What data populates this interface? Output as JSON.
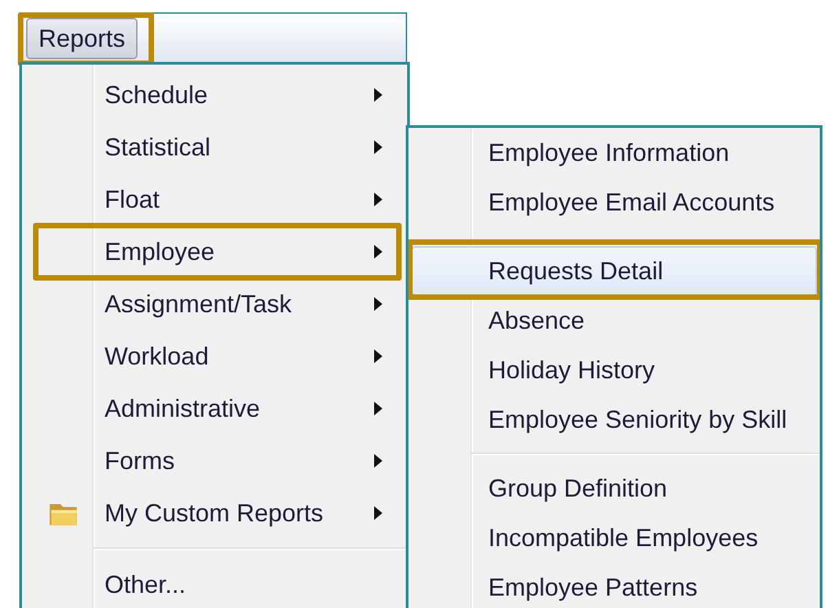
{
  "menu_bar": {
    "title": {
      "label": "Reports",
      "outlined": true
    }
  },
  "menu": {
    "items": [
      {
        "kind": "item",
        "label": "Schedule",
        "submenu": true,
        "outlined": false
      },
      {
        "kind": "item",
        "label": "Statistical",
        "submenu": true,
        "outlined": false
      },
      {
        "kind": "item",
        "label": "Float",
        "submenu": true,
        "outlined": false
      },
      {
        "kind": "item",
        "label": "Employee",
        "submenu": true,
        "outlined": true
      },
      {
        "kind": "item",
        "label": "Assignment/Task",
        "submenu": true,
        "outlined": false
      },
      {
        "kind": "item",
        "label": "Workload",
        "submenu": true,
        "outlined": false
      },
      {
        "kind": "item",
        "label": "Administrative",
        "submenu": true,
        "outlined": false
      },
      {
        "kind": "item",
        "label": "Forms",
        "submenu": true,
        "outlined": false
      },
      {
        "kind": "folder",
        "label": "My Custom Reports",
        "submenu": true,
        "outlined": false
      },
      {
        "kind": "separator"
      },
      {
        "kind": "item",
        "label": "Other...",
        "submenu": false,
        "outlined": false
      }
    ]
  },
  "submenu": {
    "items": [
      {
        "kind": "item",
        "label": "Employee Information",
        "selected": false,
        "outlined": false
      },
      {
        "kind": "item",
        "label": "Employee Email Accounts",
        "selected": false,
        "outlined": false
      },
      {
        "kind": "spacer"
      },
      {
        "kind": "item",
        "label": "Requests Detail",
        "selected": true,
        "outlined": true
      },
      {
        "kind": "item",
        "label": "Absence",
        "selected": false,
        "outlined": false
      },
      {
        "kind": "item",
        "label": "Holiday History",
        "selected": false,
        "outlined": false
      },
      {
        "kind": "item",
        "label": "Employee Seniority by Skill",
        "selected": false,
        "outlined": false
      },
      {
        "kind": "separator"
      },
      {
        "kind": "item",
        "label": "Group Definition",
        "selected": false,
        "outlined": false
      },
      {
        "kind": "item",
        "label": "Incompatible Employees",
        "selected": false,
        "outlined": false
      },
      {
        "kind": "item",
        "label": "Employee Patterns",
        "selected": false,
        "outlined": false
      }
    ]
  }
}
